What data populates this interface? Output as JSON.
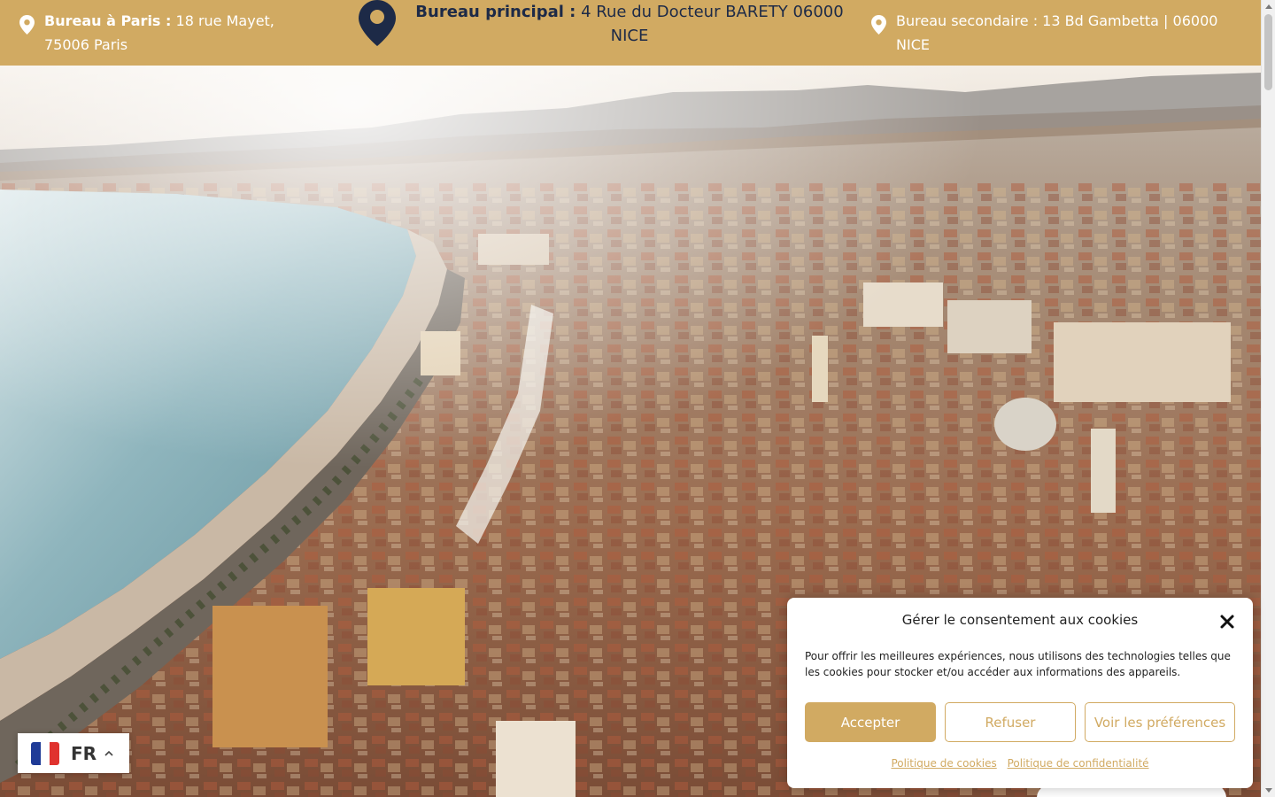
{
  "topbar": {
    "paris": {
      "label": "Bureau à Paris :",
      "value": "18 rue Mayet, 75006 Paris"
    },
    "main": {
      "label": "Bureau principal :",
      "value": "4 Rue du Docteur BARETY 06000 NICE"
    },
    "secondary": {
      "value": "Bureau secondaire : 13 Bd Gambetta | 06000 NICE"
    },
    "icons": [
      "map-pin-icon",
      "map-pin-icon",
      "map-pin-icon"
    ],
    "colors": {
      "background": "#d1aa62",
      "main_text": "#1d2a47",
      "text": "#ffffff"
    }
  },
  "hero": {
    "subject": "aerial-view-nice"
  },
  "language": {
    "code": "FR",
    "flag": "france-flag-icon",
    "chevron": "chevron-up-icon"
  },
  "cookie_banner": {
    "title": "Gérer le consentement aux cookies",
    "body": "Pour offrir les meilleures expériences, nous utilisons des technologies telles que les cookies pour stocker et/ou accéder aux informations des appareils.",
    "accept_label": "Accepter",
    "refuse_label": "Refuser",
    "preferences_label": "Voir les préférences",
    "cookie_policy_label": "Politique de cookies",
    "privacy_policy_label": "Politique de confidentialité",
    "close_icon": "close-icon",
    "accent_color": "#d1aa62"
  }
}
